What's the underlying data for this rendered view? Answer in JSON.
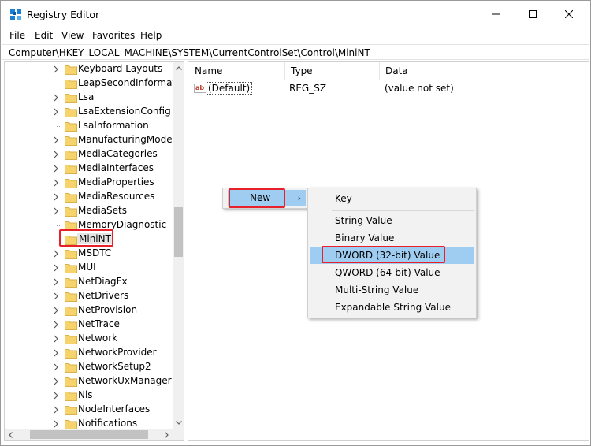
{
  "window": {
    "title": "Registry Editor"
  },
  "menubar": [
    "File",
    "Edit",
    "View",
    "Favorites",
    "Help"
  ],
  "address": "Computer\\HKEY_LOCAL_MACHINE\\SYSTEM\\CurrentControlSet\\Control\\MiniNT",
  "tree": {
    "items": [
      {
        "label": "Keyboard Layouts",
        "expandable": true
      },
      {
        "label": "LeapSecondInformati",
        "expandable": false
      },
      {
        "label": "Lsa",
        "expandable": true
      },
      {
        "label": "LsaExtensionConfig",
        "expandable": true
      },
      {
        "label": "LsaInformation",
        "expandable": false
      },
      {
        "label": "ManufacturingMode",
        "expandable": true
      },
      {
        "label": "MediaCategories",
        "expandable": true
      },
      {
        "label": "MediaInterfaces",
        "expandable": true
      },
      {
        "label": "MediaProperties",
        "expandable": true
      },
      {
        "label": "MediaResources",
        "expandable": true
      },
      {
        "label": "MediaSets",
        "expandable": true
      },
      {
        "label": "MemoryDiagnostic",
        "expandable": false
      },
      {
        "label": "MiniNT",
        "expandable": false,
        "selected": true
      },
      {
        "label": "MSDTC",
        "expandable": true
      },
      {
        "label": "MUI",
        "expandable": true
      },
      {
        "label": "NetDiagFx",
        "expandable": true
      },
      {
        "label": "NetDrivers",
        "expandable": true
      },
      {
        "label": "NetProvision",
        "expandable": true
      },
      {
        "label": "NetTrace",
        "expandable": true
      },
      {
        "label": "Network",
        "expandable": true
      },
      {
        "label": "NetworkProvider",
        "expandable": true
      },
      {
        "label": "NetworkSetup2",
        "expandable": true
      },
      {
        "label": "NetworkUxManager",
        "expandable": true
      },
      {
        "label": "Nls",
        "expandable": true
      },
      {
        "label": "NodeInterfaces",
        "expandable": true
      },
      {
        "label": "Notifications",
        "expandable": true
      }
    ]
  },
  "list": {
    "columns": [
      "Name",
      "Type",
      "Data"
    ],
    "rows": [
      {
        "name": "(Default)",
        "type": "REG_SZ",
        "data": "(value not set)"
      }
    ]
  },
  "context_menu": {
    "new_label": "New",
    "submenu": [
      "Key",
      "String Value",
      "Binary Value",
      "DWORD (32-bit) Value",
      "QWORD (64-bit) Value",
      "Multi-String Value",
      "Expandable String Value"
    ],
    "hovered": "DWORD (32-bit) Value"
  },
  "colors": {
    "highlight_box": "#e8202a",
    "menu_hover": "#9fcdf1",
    "folder": "#f6d36b"
  }
}
